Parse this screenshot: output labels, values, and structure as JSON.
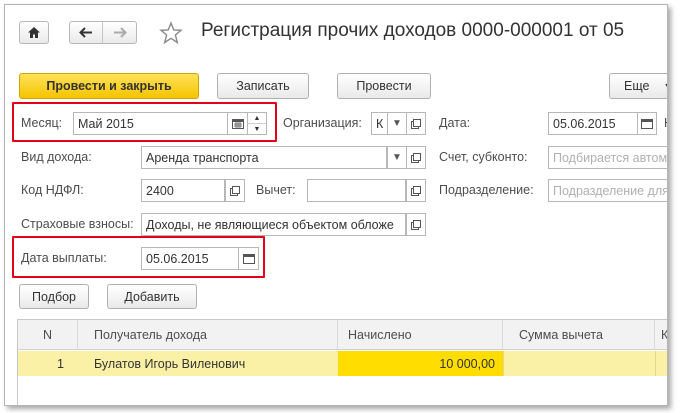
{
  "window": {
    "title": "Регистрация прочих доходов 0000-000001 от 05",
    "favorite_icon": "star-icon"
  },
  "toolbar": {
    "post_close_label": "Провести и закрыть",
    "write_label": "Записать",
    "post_label": "Провести",
    "more_label": "Еще",
    "more_icon": "chevron-down-icon"
  },
  "form": {
    "month": {
      "label": "Месяц:",
      "value": "Май 2015"
    },
    "organization": {
      "label": "Организация:",
      "value": "К"
    },
    "date": {
      "label": "Дата:",
      "value": "05.06.2015",
      "next_label": "Н"
    },
    "income_type": {
      "label": "Вид дохода:",
      "value": "Аренда транспорта"
    },
    "account": {
      "label": "Счет, субконто:",
      "placeholder": "Подбирается автома"
    },
    "ndfl_code": {
      "label": "Код НДФЛ:",
      "value": "2400"
    },
    "deduction": {
      "label": "Вычет:",
      "value": ""
    },
    "department": {
      "label": "Подразделение:",
      "placeholder": "Подразделение для"
    },
    "insurance": {
      "label": "Страховые взносы:",
      "value": "Доходы, не являющиеся объектом обложе"
    },
    "payment_date": {
      "label": "Дата выплаты:",
      "value": "05.06.2015"
    }
  },
  "table_toolbar": {
    "select_label": "Подбор",
    "add_label": "Добавить"
  },
  "table": {
    "columns": [
      "N",
      "Получатель дохода",
      "Начислено",
      "Сумма вычета",
      "К"
    ],
    "rows": [
      {
        "n": "1",
        "recipient": "Булатов Игорь Виленович",
        "accrued": "10 000,00",
        "deduction": ""
      }
    ]
  },
  "colors": {
    "accent_yellow": "#f5c400",
    "highlight_row": "#fbf1a6",
    "cell_highlight": "#ffdd00",
    "annotation_red": "#e2001a"
  }
}
